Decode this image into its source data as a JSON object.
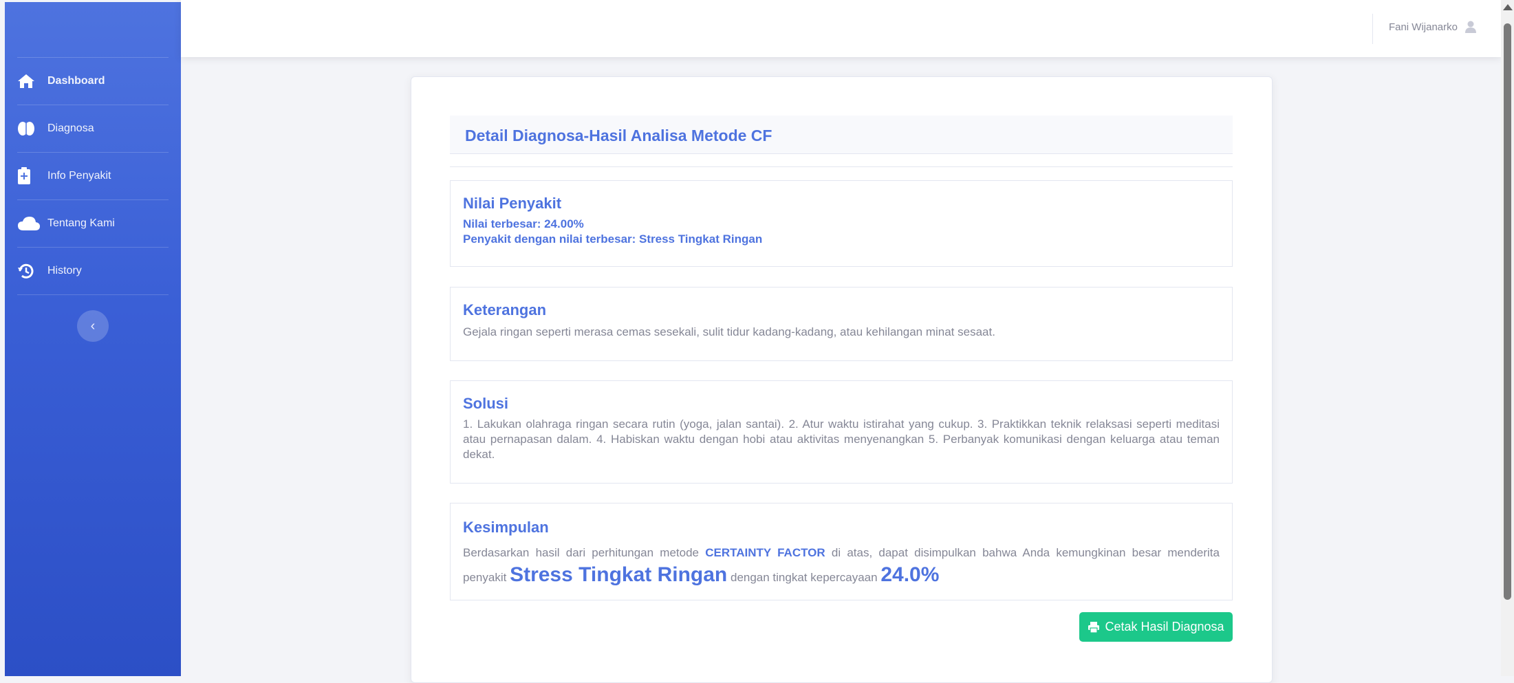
{
  "sidebar": {
    "items": [
      {
        "label": "Dashboard",
        "icon": "home-icon"
      },
      {
        "label": "Diagnosa",
        "icon": "brain-icon"
      },
      {
        "label": "Info Penyakit",
        "icon": "clipboard-plus-icon"
      },
      {
        "label": "Tentang Kami",
        "icon": "cloud-icon"
      },
      {
        "label": "History",
        "icon": "history-icon"
      }
    ],
    "toggle_icon": "chevron-left-icon"
  },
  "topbar": {
    "user_name": "Fani Wijanarko",
    "user_icon": "user-icon"
  },
  "card": {
    "title": "Detail Diagnosa-Hasil Analisa Metode CF",
    "nilai": {
      "heading": "Nilai Penyakit",
      "line1": "Nilai terbesar: 24.00%",
      "line2": "Penyakit dengan nilai terbesar: Stress Tingkat Ringan"
    },
    "keterangan": {
      "heading": "Keterangan",
      "text": "Gejala ringan seperti merasa cemas sesekali, sulit tidur kadang-kadang, atau kehilangan minat sesaat."
    },
    "solusi": {
      "heading": "Solusi",
      "text": "1. Lakukan olahraga ringan secara rutin (yoga, jalan santai). 2. Atur waktu istirahat yang cukup. 3. Praktikkan teknik relaksasi seperti meditasi atau pernapasan dalam. 4. Habiskan waktu dengan hobi atau aktivitas menyenangkan 5. Perbanyak komunikasi dengan keluarga atau teman dekat."
    },
    "kesimpulan": {
      "heading": "Kesimpulan",
      "text1": "Berdasarkan hasil dari perhitungan metode",
      "method": "CERTAINTY FACTOR",
      "text2": "di atas, dapat disimpulkan bahwa Anda kemungkinan besar menderita penyakit",
      "disease": "Stress Tingkat Ringan",
      "text3": "dengan tingkat kepercayaan",
      "confidence": "24.0%"
    },
    "print_button": "Cetak Hasil Diagnosa",
    "print_icon": "printer-icon"
  },
  "colors": {
    "primary": "#4e73df",
    "success": "#1cc88a",
    "text": "#858796"
  }
}
